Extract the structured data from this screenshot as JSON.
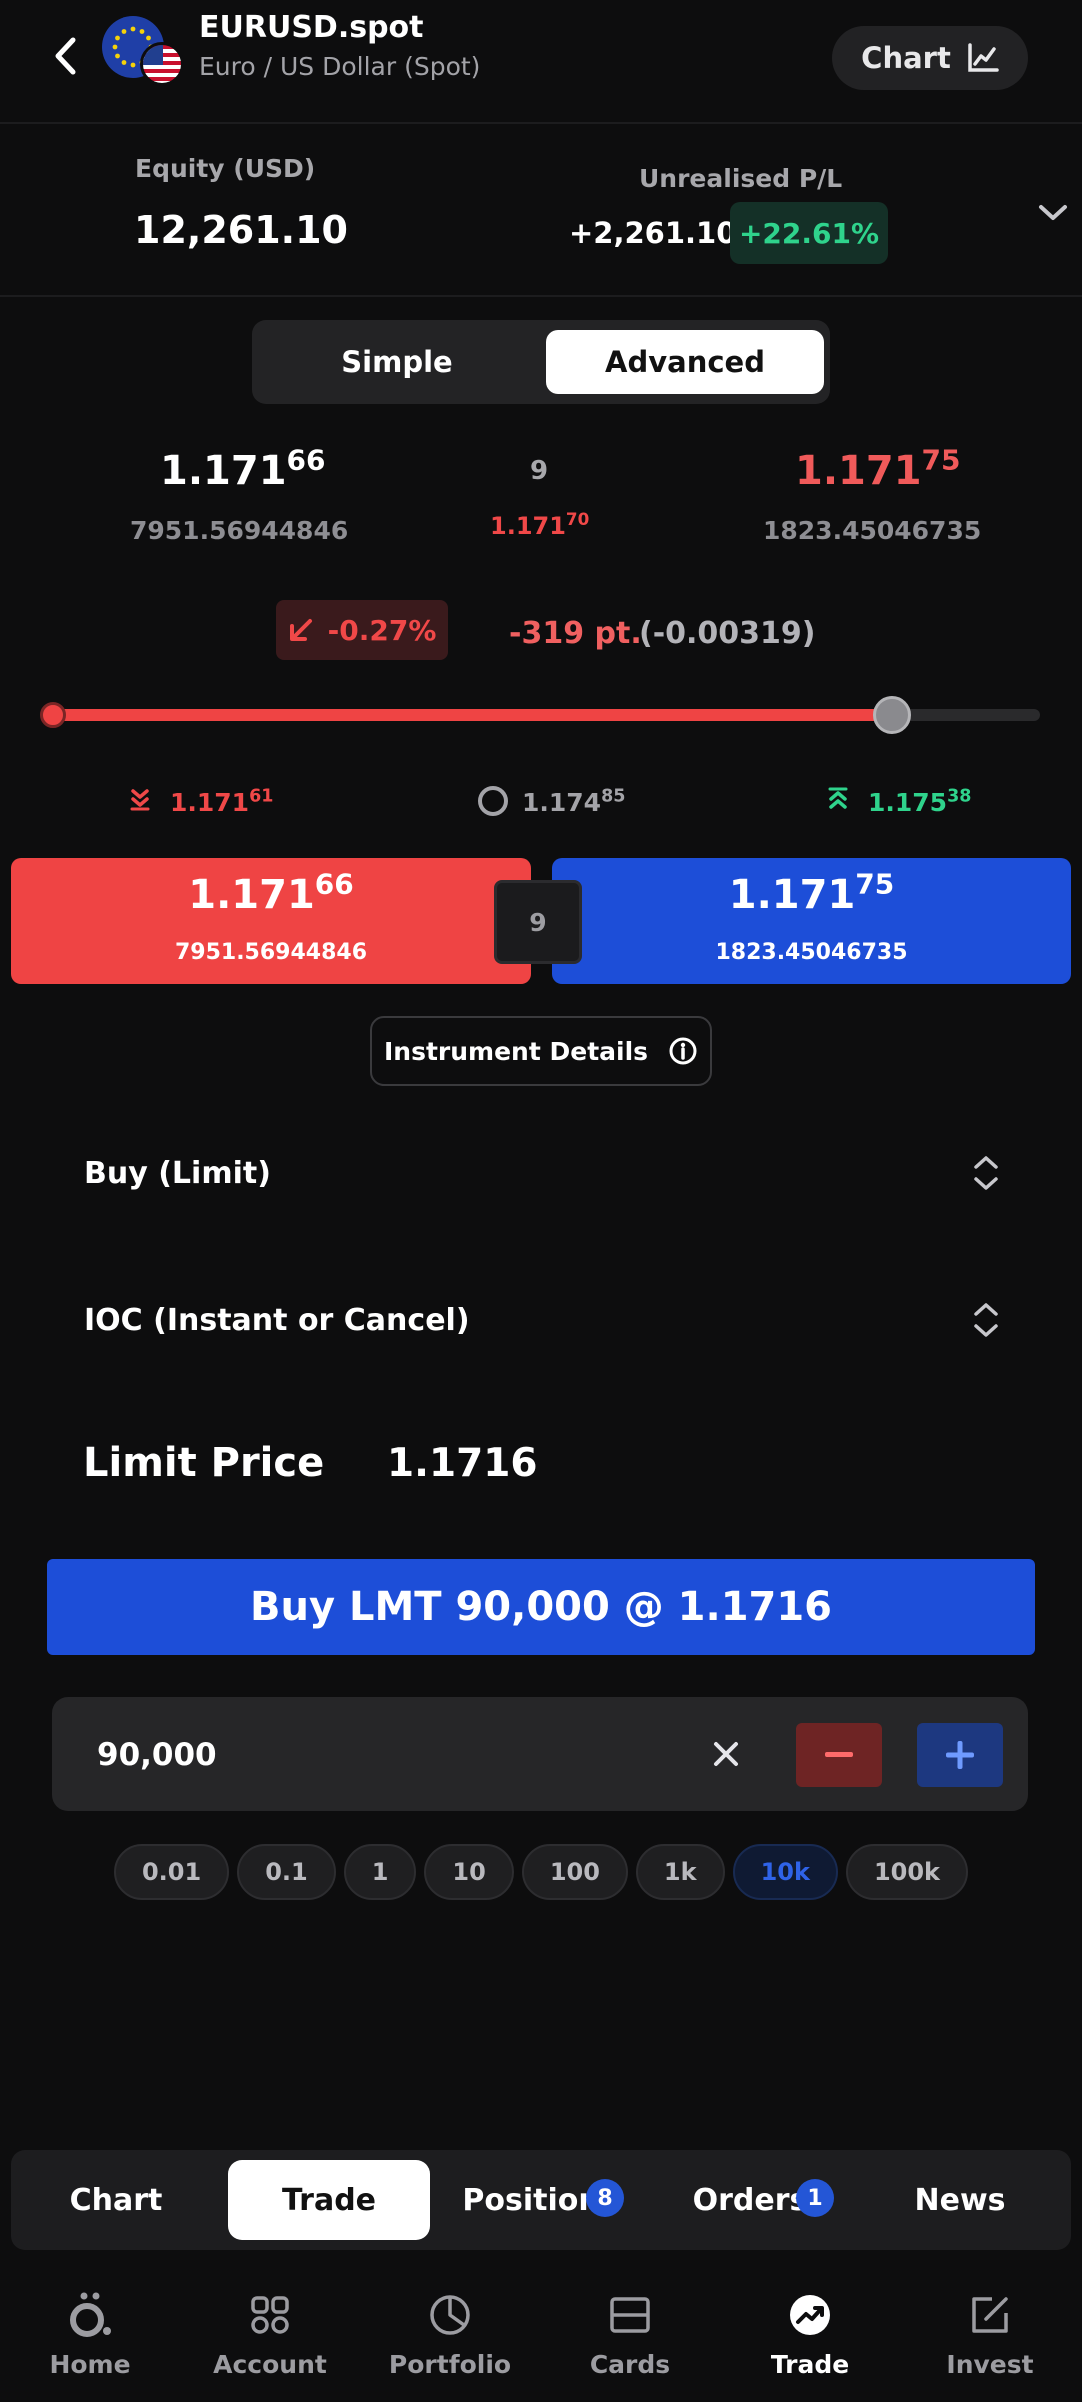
{
  "header": {
    "title": "EURUSD.spot",
    "subtitle": "Euro / US Dollar (Spot)",
    "chart_button_label": "Chart"
  },
  "account": {
    "equity_label": "Equity (USD)",
    "equity_value": "12,261.10",
    "pl_label": "Unrealised P/L",
    "pl_value": "+2,261.10",
    "pl_percent": "+22.61%"
  },
  "mode_toggle": {
    "options": [
      "Simple",
      "Advanced"
    ],
    "selected": "Advanced"
  },
  "quote": {
    "bid_base": "1.171",
    "bid_pips": "66",
    "bid_volume": "7951.56944846",
    "spread": "9",
    "mid_base": "1.171",
    "mid_pips": "70",
    "ask_base": "1.171",
    "ask_pips": "75",
    "ask_volume": "1823.45046735"
  },
  "change": {
    "percent": "-0.27%",
    "points": "-319 pt.",
    "absolute": "(-0.00319)"
  },
  "day_range": {
    "position_fraction": 0.85,
    "low_base": "1.171",
    "low_pips": "61",
    "open_base": "1.174",
    "open_pips": "85",
    "high_base": "1.175",
    "high_pips": "38"
  },
  "trade_buttons": {
    "sell_base": "1.171",
    "sell_pips": "66",
    "sell_volume": "7951.56944846",
    "spread": "9",
    "buy_base": "1.171",
    "buy_pips": "75",
    "buy_volume": "1823.45046735"
  },
  "instrument_details_label": "Instrument Details",
  "order": {
    "side_type": "Buy (Limit)",
    "time_in_force": "IOC (Instant or Cancel)",
    "limit_price_label": "Limit Price",
    "limit_price_value": "1.1716",
    "submit_label": "Buy LMT 90,000 @ 1.1716",
    "quantity": "90,000",
    "increments": [
      "0.01",
      "0.1",
      "1",
      "10",
      "100",
      "1k",
      "10k",
      "100k"
    ],
    "selected_increment": "10k"
  },
  "trade_tabs": {
    "items": [
      {
        "label": "Chart"
      },
      {
        "label": "Trade"
      },
      {
        "label": "Positions",
        "badge": "8"
      },
      {
        "label": "Orders",
        "badge": "1"
      },
      {
        "label": "News"
      }
    ],
    "selected": "Trade"
  },
  "bottom_nav": {
    "items": [
      {
        "label": "Home",
        "icon": "home-logo-icon"
      },
      {
        "label": "Account",
        "icon": "account-icon"
      },
      {
        "label": "Portfolio",
        "icon": "pie-chart-icon"
      },
      {
        "label": "Cards",
        "icon": "card-icon"
      },
      {
        "label": "Trade",
        "icon": "trade-icon"
      },
      {
        "label": "Invest",
        "icon": "invest-icon"
      }
    ],
    "selected": "Trade"
  },
  "colors": {
    "background": "#0d0d0e",
    "sell_red": "#ef4444",
    "buy_blue": "#1d4ed8",
    "positive_green": "#2fd38c"
  }
}
